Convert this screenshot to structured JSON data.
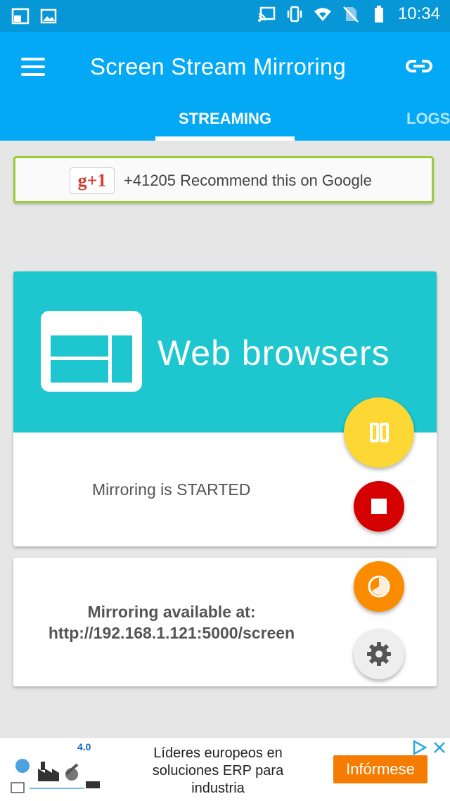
{
  "status_bar": {
    "time": "10:34",
    "left_icons": [
      "screenshot-icon",
      "image-icon"
    ],
    "right_icons": [
      "cast-icon",
      "vibrate-icon",
      "wifi-icon",
      "no-sim-icon",
      "battery-icon"
    ]
  },
  "app_bar": {
    "title": "Screen Stream Mirroring",
    "menu_icon": "hamburger-menu-icon",
    "action_icon": "link-icon",
    "tabs": [
      {
        "label": "STREAMING",
        "active": true
      },
      {
        "label": "LOGS",
        "active": false
      }
    ]
  },
  "gplus_card": {
    "button_label": "g+1",
    "text": "+41205 Recommend this on Google"
  },
  "mirror_card": {
    "hero_title": "Web browsers",
    "hero_icon": "browser-window-icon",
    "status": "Mirroring is STARTED",
    "pause_icon": "pause-icon",
    "stop_icon": "stop-icon"
  },
  "address_card": {
    "label": "Mirroring available at:",
    "url": "http://192.168.1.121:5000/screen",
    "timer_icon": "timer-icon",
    "settings_icon": "gear-icon"
  },
  "ad": {
    "line1": "Líderes europeos en",
    "line2": "soluciones ERP para",
    "line3": "industria",
    "button": "Infórmese",
    "image_label": "4.0"
  },
  "colors": {
    "status_bar": "#0797d7",
    "app_bar": "#03a9f4",
    "hero": "#1ec6cf",
    "pause_fab": "#fdd835",
    "stop_fab": "#d50000",
    "timer_fab": "#fb8c00",
    "ad_button": "#f57c00",
    "gplus_border": "#9ccc3a"
  }
}
